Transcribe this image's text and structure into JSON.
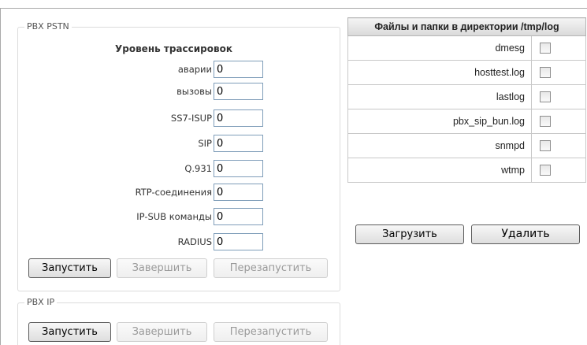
{
  "pbx_pstn": {
    "legend": "PBX PSTN",
    "trace_title": "Уровень трассировок",
    "fields": [
      {
        "label": "аварии",
        "value": "0"
      },
      {
        "label": "вызовы",
        "value": "0"
      },
      {
        "label": "SS7-ISUP",
        "value": "0"
      },
      {
        "label": "SIP",
        "value": "0"
      },
      {
        "label": "Q.931",
        "value": "0"
      },
      {
        "label": "RTP-соединения",
        "value": "0"
      },
      {
        "label": "IP-SUB команды",
        "value": "0"
      },
      {
        "label": "RADIUS",
        "value": "0"
      }
    ],
    "buttons": {
      "start": "Запустить",
      "stop": "Завершить",
      "restart": "Перезапустить"
    }
  },
  "pbx_ip": {
    "legend": "PBX IP",
    "buttons": {
      "start": "Запустить",
      "stop": "Завершить",
      "restart": "Перезапустить"
    }
  },
  "files": {
    "header": "Файлы и папки в директории /tmp/log",
    "rows": [
      {
        "name": "dmesg",
        "checked": false
      },
      {
        "name": "hosttest.log",
        "checked": false
      },
      {
        "name": "lastlog",
        "checked": false
      },
      {
        "name": "pbx_sip_bun.log",
        "checked": false
      },
      {
        "name": "snmpd",
        "checked": false
      },
      {
        "name": "wtmp",
        "checked": false
      }
    ],
    "buttons": {
      "download": "Загрузить",
      "delete": "Удалить"
    }
  }
}
